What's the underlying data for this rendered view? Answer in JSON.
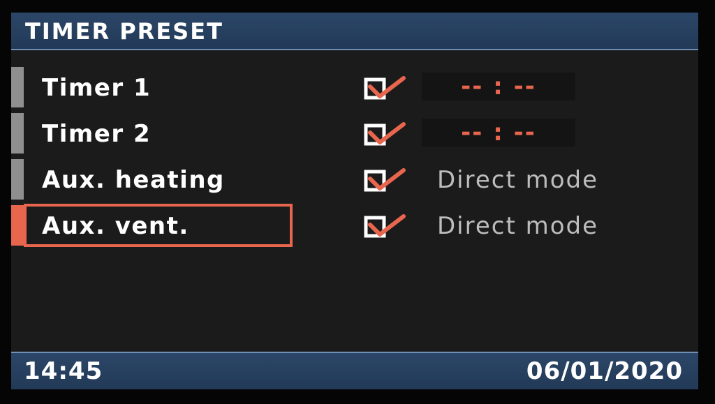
{
  "header": {
    "title": "TIMER PRESET"
  },
  "rows": [
    {
      "label": "Timer 1",
      "value": "-- : --",
      "checked": true
    },
    {
      "label": "Timer 2",
      "value": "-- : --",
      "checked": true
    },
    {
      "label": "Aux. heating",
      "value": "Direct mode",
      "checked": true
    },
    {
      "label": "Aux. vent.",
      "value": "Direct mode",
      "checked": true
    }
  ],
  "selected_row": "Aux. vent.",
  "footer": {
    "time": "14:45",
    "date": "06/01/2020"
  },
  "colors": {
    "accent": "#e8664d",
    "header_bg": "#2c4668",
    "screen_bg": "#1b1b1c",
    "text": "#ffffff",
    "muted_text": "#bdbdbd"
  },
  "icons": {
    "checkbox": "checkbox-checked-icon"
  }
}
